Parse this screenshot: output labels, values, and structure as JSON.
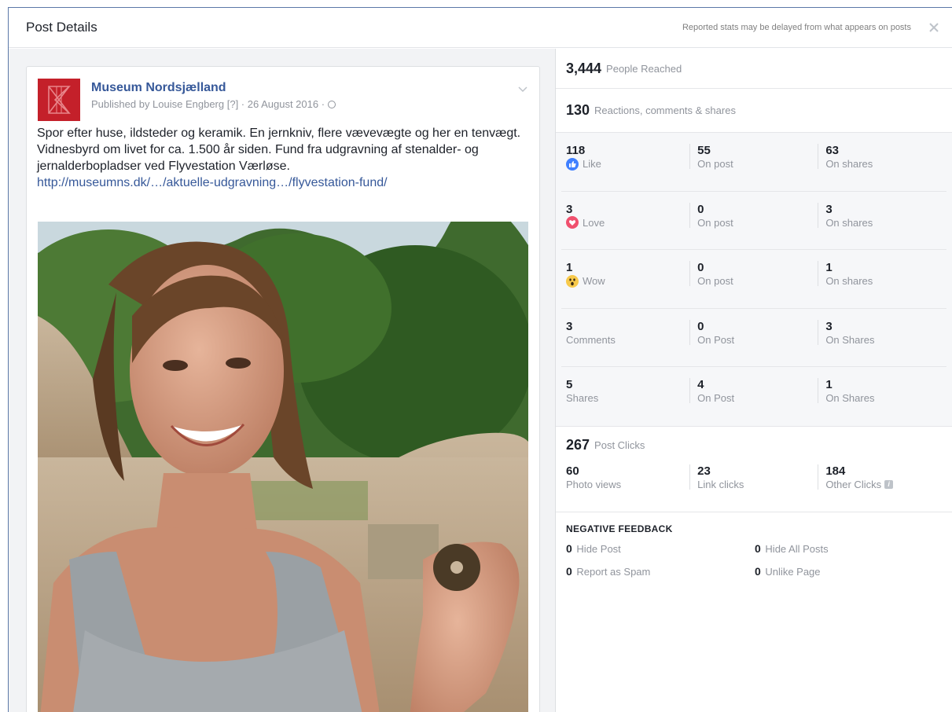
{
  "dialog": {
    "title": "Post Details",
    "note": "Reported stats may be delayed from what appears on posts"
  },
  "post": {
    "page_name": "Museum Nordsjælland",
    "published": "Published by Louise Engberg [?] · 26 August 2016 · ",
    "text": "Spor efter huse, ildsteder og keramik. En jernkniv, flere vævevægte og her en tenvægt. Vidnesbyrd om livet for ca. 1.500 år siden. Fund fra udgravning af stenalder- og jernalderbopladser ved Flyvestation Værløse.",
    "link": "http://museumns.dk/…/aktuelle-udgravning…/flyvestation-fund/"
  },
  "reach": {
    "value": "3,444",
    "label": "People Reached"
  },
  "engagement": {
    "value": "130",
    "label": "Reactions, comments & shares"
  },
  "stats": [
    {
      "name": "like",
      "icon": "like-icon",
      "total": "118",
      "label": "Like",
      "post": "55",
      "post_label": "On post",
      "shares": "63",
      "shares_label": "On shares"
    },
    {
      "name": "love",
      "icon": "love-icon",
      "total": "3",
      "label": "Love",
      "post": "0",
      "post_label": "On post",
      "shares": "3",
      "shares_label": "On shares"
    },
    {
      "name": "wow",
      "icon": "wow-icon",
      "total": "1",
      "label": "Wow",
      "post": "0",
      "post_label": "On post",
      "shares": "1",
      "shares_label": "On shares"
    },
    {
      "name": "comments",
      "icon": "",
      "total": "3",
      "label": "Comments",
      "post": "0",
      "post_label": "On Post",
      "shares": "3",
      "shares_label": "On Shares"
    },
    {
      "name": "shares",
      "icon": "",
      "total": "5",
      "label": "Shares",
      "post": "4",
      "post_label": "On Post",
      "shares": "1",
      "shares_label": "On Shares"
    }
  ],
  "clicks": {
    "value": "267",
    "label": "Post Clicks",
    "photo_views": "60",
    "photo_views_label": "Photo views",
    "link_clicks": "23",
    "link_clicks_label": "Link clicks",
    "other_clicks": "184",
    "other_clicks_label": "Other Clicks"
  },
  "negative": {
    "title": "NEGATIVE FEEDBACK",
    "items": [
      {
        "value": "0",
        "label": "Hide Post"
      },
      {
        "value": "0",
        "label": "Hide All Posts"
      },
      {
        "value": "0",
        "label": "Report as Spam"
      },
      {
        "value": "0",
        "label": "Unlike Page"
      }
    ]
  },
  "colors": {
    "link": "#365899",
    "like_blue": "#4080ff",
    "love_red": "#f0506e",
    "wow_yellow": "#f7c94b"
  }
}
